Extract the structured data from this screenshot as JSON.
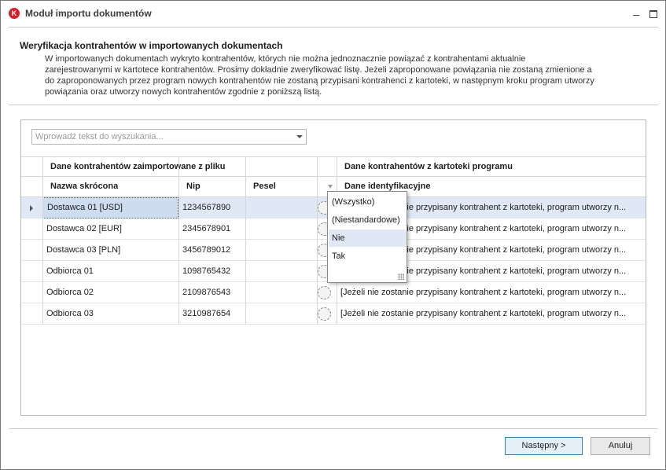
{
  "window": {
    "logo_letter": "K",
    "title": "Moduł importu dokumentów"
  },
  "header": {
    "title": "Weryfikacja kontrahentów w importowanych dokumentach",
    "description": "W importowanych dokumentach wykryto kontrahentów, których nie można jednoznacznie powiązać z kontrahentami aktualnie zarejestrowanymi w kartotece kontrahentów. Prosimy dokładnie zweryfikować listę. Jeżeli zaproponowane powiązania nie zostaną zmienione a do zaproponowanych przez program nowych kontrahentów nie zostaną przypisani kontrahenci z kartoteki, w następnym kroku program utworzy powiązania oraz utworzy nowych kontrahentów zgodnie z poniższą listą."
  },
  "search": {
    "placeholder": "Wprowadź tekst do wyszukania..."
  },
  "grid": {
    "band_left": "Dane kontrahentów zaimportowane z pliku",
    "band_right": "Dane kontrahentów z kartoteki programu",
    "columns": {
      "name": "Nazwa skrócona",
      "nip": "Nip",
      "pesel": "Pesel",
      "ident": "Dane identyfikacyjne"
    },
    "rows": [
      {
        "name": "Dostawca 01 [USD]",
        "nip": "1234567890",
        "pesel": "",
        "ident": "[Jeżeli nie zostanie przypisany kontrahent z kartoteki, program utworzy n..."
      },
      {
        "name": "Dostawca 02 [EUR]",
        "nip": "2345678901",
        "pesel": "",
        "ident": "[Jeżeli nie zostanie przypisany kontrahent z kartoteki, program utworzy n..."
      },
      {
        "name": "Dostawca 03 [PLN]",
        "nip": "3456789012",
        "pesel": "",
        "ident": "[Jeżeli nie zostanie przypisany kontrahent z kartoteki, program utworzy n..."
      },
      {
        "name": "Odbiorca 01",
        "nip": "1098765432",
        "pesel": "",
        "ident": "[Jeżeli nie zostanie przypisany kontrahent z kartoteki, program utworzy n..."
      },
      {
        "name": "Odbiorca 02",
        "nip": "2109876543",
        "pesel": "",
        "ident": "[Jeżeli nie zostanie przypisany kontrahent z kartoteki, program utworzy n..."
      },
      {
        "name": "Odbiorca 03",
        "nip": "3210987654",
        "pesel": "",
        "ident": "[Jeżeli nie zostanie przypisany kontrahent z kartoteki, program utworzy n..."
      }
    ]
  },
  "filter_popup": {
    "items": [
      "(Wszystko)",
      "(Niestandardowe)",
      "Nie",
      "Tak"
    ],
    "highlighted": "Nie"
  },
  "footer": {
    "next_label": "Następny >",
    "cancel_label": "Anuluj"
  },
  "colors": {
    "selection": "#dfe8f4",
    "logo": "#d9202a",
    "primary_border": "#3c7fb1"
  }
}
